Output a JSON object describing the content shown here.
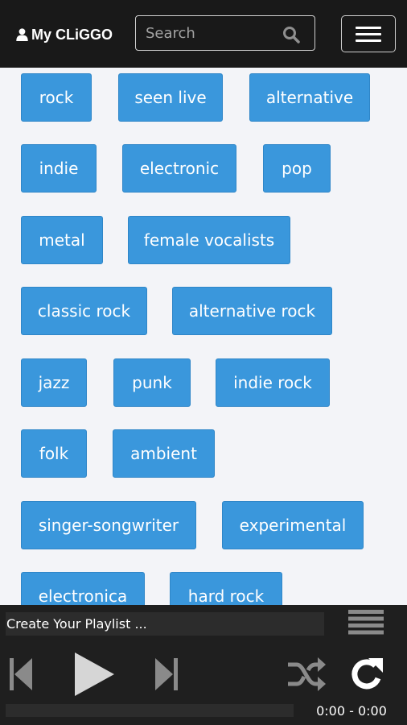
{
  "navbar": {
    "brand": "My CLiGGO",
    "search_placeholder": "Search"
  },
  "tags": [
    "rock",
    "seen live",
    "alternative",
    "indie",
    "electronic",
    "pop",
    "metal",
    "female vocalists",
    "classic rock",
    "alternative rock",
    "jazz",
    "punk",
    "indie rock",
    "folk",
    "ambient",
    "singer-songwriter",
    "experimental",
    "electronica",
    "hard rock"
  ],
  "player": {
    "playlist_label": "Create Your Playlist ...",
    "time": "0:00 - 0:00",
    "progress": 0,
    "icons": {
      "previous": "skip-previous-icon",
      "play": "play-icon",
      "next": "skip-next-icon",
      "shuffle": "shuffle-icon",
      "repeat": "repeat-icon",
      "queue": "queue-list-icon"
    }
  }
}
